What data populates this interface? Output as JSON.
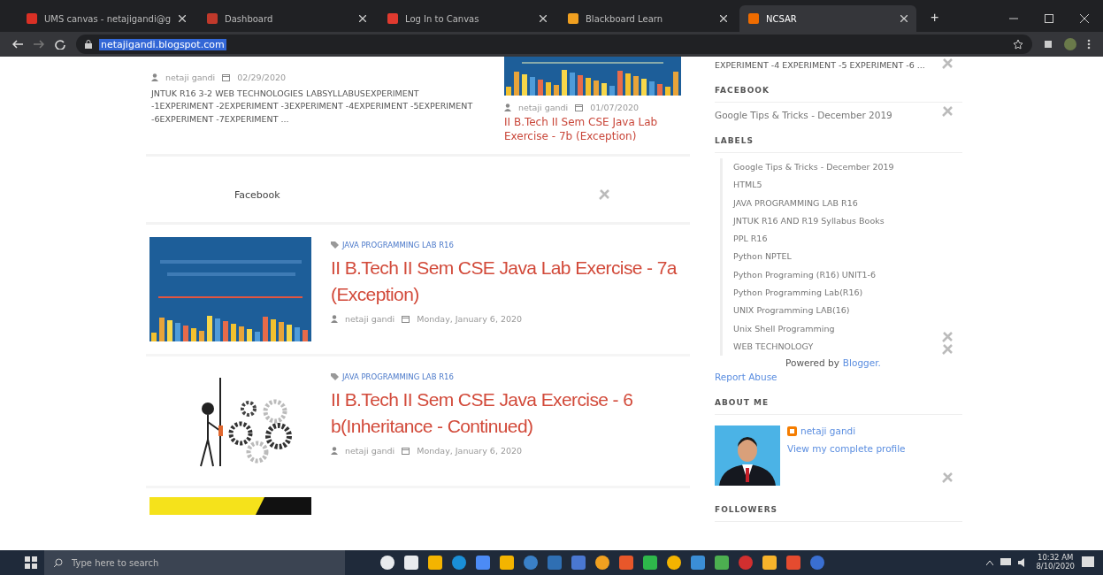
{
  "browser": {
    "tabs": [
      {
        "title": "UMS canvas - netajigandi@g",
        "selected": false
      },
      {
        "title": "Dashboard",
        "selected": false
      },
      {
        "title": "Log In to Canvas",
        "selected": false
      },
      {
        "title": "Blackboard Learn",
        "selected": false
      },
      {
        "title": "NCSAR",
        "selected": true
      }
    ],
    "new_tab": "+",
    "address": "netajigandi.blogspot.com"
  },
  "main": {
    "top_left_post": {
      "author": "netaji gandi",
      "date": "02/29/2020",
      "excerpt": "JNTUK R16 3-2 WEB TECHNOLOGIES LABSYLLABUSEXPERIMENT -1EXPERIMENT -2EXPERIMENT -3EXPERIMENT -4EXPERIMENT -5EXPERIMENT -6EXPERIMENT -7EXPERIMENT ..."
    },
    "top_right_post": {
      "author": "netaji gandi",
      "date": "01/07/2020",
      "title": "II B.Tech II Sem CSE Java Lab Exercise - 7b (Exception)"
    },
    "facebook_widget": {
      "title": "Facebook"
    },
    "posts": [
      {
        "label": "JAVA PROGRAMMING LAB R16",
        "title": "II B.Tech II Sem CSE Java Lab Exercise - 7a (Exception)",
        "author": "netaji gandi",
        "date": "Monday, January 6, 2020",
        "kind": "banner"
      },
      {
        "label": "JAVA PROGRAMMING LAB R16",
        "title": "II B.Tech II Sem CSE Java Exercise - 6 b(Inheritance - Continued)",
        "author": "netaji gandi",
        "date": "Monday, January 6, 2020",
        "kind": "gears"
      }
    ]
  },
  "sidebar": {
    "excerpt_tail": "EXPERIMENT -4 EXPERIMENT -5 EXPERIMENT -6 ...",
    "facebook": {
      "heading": "FACEBOOK",
      "link": "Google Tips & Tricks - December 2019"
    },
    "labels": {
      "heading": "LABELS",
      "items": [
        "Google Tips & Tricks - December 2019",
        "HTML5",
        "JAVA PROGRAMMING LAB R16",
        "JNTUK R16 AND R19 Syllabus Books",
        "PPL R16",
        "Python NPTEL",
        "Python Programing (R16) UNIT1-6",
        "Python Programming Lab(R16)",
        "UNIX Programming LAB(16)",
        "Unix Shell Programming",
        "WEB TECHNOLOGY"
      ]
    },
    "powered_by": "Powered by",
    "blogger": "Blogger.",
    "report_abuse": "Report Abuse",
    "about": {
      "heading": "ABOUT ME",
      "name": "netaji gandi",
      "profile_link": "View my complete profile"
    },
    "followers": {
      "heading": "FOLLOWERS"
    }
  },
  "taskbar": {
    "search_placeholder": "Type here to search",
    "time": "10:32 AM",
    "date": "8/10/2020"
  }
}
